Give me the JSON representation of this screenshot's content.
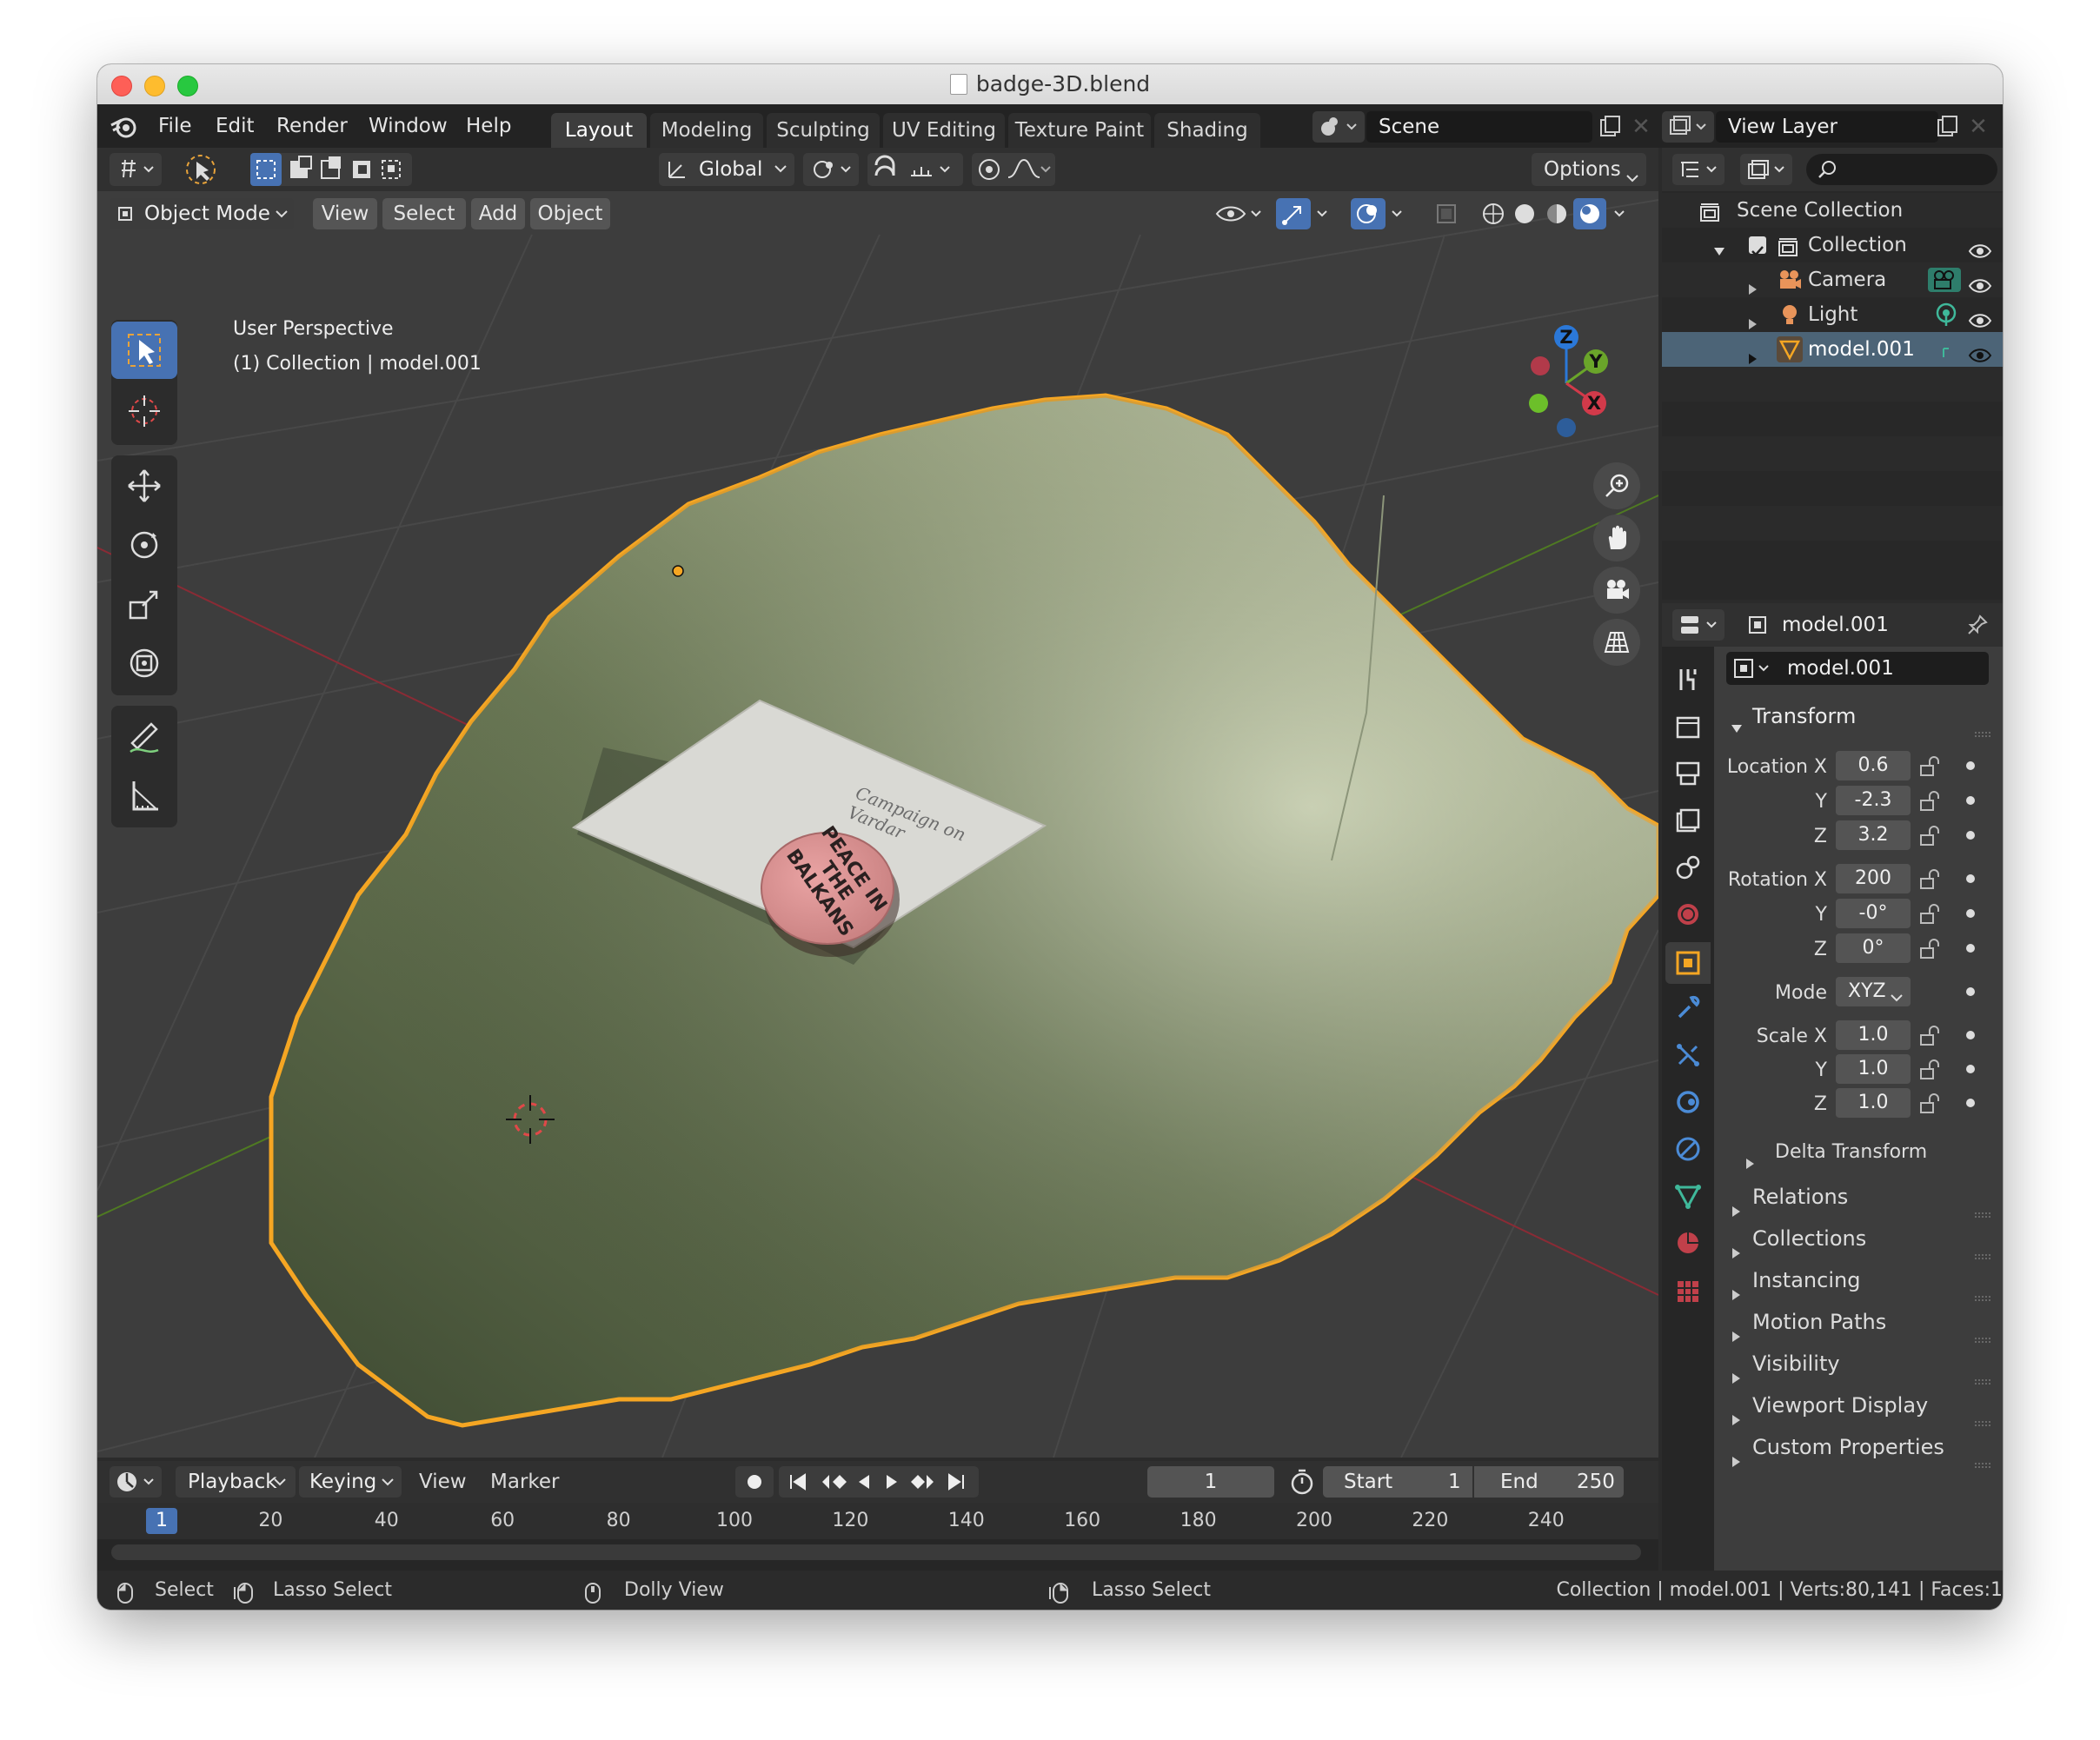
{
  "window": {
    "title": "badge-3D.blend"
  },
  "menu": [
    "File",
    "Edit",
    "Render",
    "Window",
    "Help"
  ],
  "workspaces": [
    "Layout",
    "Modeling",
    "Sculpting",
    "UV Editing",
    "Texture Paint",
    "Shading"
  ],
  "active_workspace": "Layout",
  "scene": "Scene",
  "view_layer": "View Layer",
  "tool_header": {
    "orientation": "Global",
    "options": "Options"
  },
  "viewport_header": {
    "mode": "Object Mode",
    "view": "View",
    "select": "Select",
    "add": "Add",
    "object": "Object"
  },
  "viewport": {
    "perspective": "User Perspective",
    "collection_info": "(1) Collection | model.001",
    "object_text": {
      "badge": "PEACE IN THE BALKANS",
      "note": "Campaign on Vardar"
    }
  },
  "gizmo": {
    "z": "Z",
    "y": "Y",
    "x": "X"
  },
  "outliner": {
    "root": "Scene Collection",
    "collection": "Collection",
    "items": [
      "Camera",
      "Light",
      "model.001"
    ],
    "selected": "model.001"
  },
  "properties": {
    "header_object": "model.001",
    "object_name": "model.001",
    "transform_label": "Transform",
    "location": {
      "label_x": "Location X",
      "label_y": "Y",
      "label_z": "Z",
      "x": "0.6",
      "y": "-2.3",
      "z": "3.2"
    },
    "rotation": {
      "label_x": "Rotation X",
      "label_y": "Y",
      "label_z": "Z",
      "x": "200",
      "y": "-0°",
      "z": "0°"
    },
    "mode": {
      "label": "Mode",
      "value": "XYZ"
    },
    "scale": {
      "label_x": "Scale X",
      "label_y": "Y",
      "label_z": "Z",
      "x": "1.0",
      "y": "1.0",
      "z": "1.0"
    },
    "delta_transform": "Delta Transform",
    "panels": [
      "Relations",
      "Collections",
      "Instancing",
      "Motion Paths",
      "Visibility",
      "Viewport Display",
      "Custom Properties"
    ]
  },
  "timeline": {
    "playback": "Playback",
    "keying": "Keying",
    "view": "View",
    "marker": "Marker",
    "current_frame": "1",
    "start_label": "Start",
    "start": "1",
    "end_label": "End",
    "end": "250",
    "ticks": [
      "1",
      "20",
      "40",
      "60",
      "80",
      "100",
      "120",
      "140",
      "160",
      "180",
      "200",
      "220",
      "240"
    ]
  },
  "statusbar": {
    "select": "Select",
    "lasso_select": "Lasso Select",
    "dolly_view": "Dolly View",
    "lasso_select_2": "Lasso Select",
    "info": "Collection | model.001 | Verts:80,141 | Faces:1"
  },
  "colors": {
    "accent_blue": "#4772b3",
    "selection_orange": "#f5a623",
    "axis_red": "#d23a4a",
    "axis_green": "#6aa52a",
    "axis_blue": "#2b78d8"
  }
}
